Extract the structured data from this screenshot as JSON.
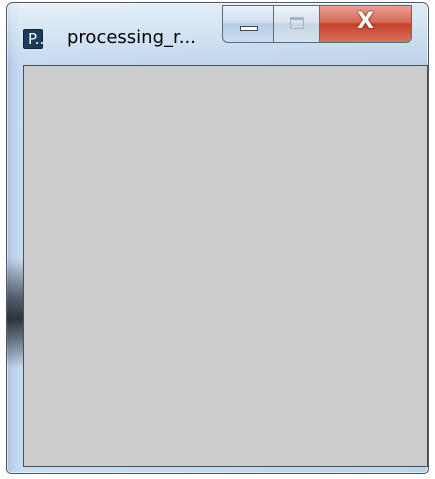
{
  "window": {
    "title": "processing_r...",
    "app_icon": "processing-app-icon",
    "app_icon_glyph": "P..",
    "caption_buttons": {
      "minimize": "minimize-icon",
      "maximize": "maximize-icon",
      "close": "close-icon"
    },
    "close_glyph": "X"
  },
  "canvas": {
    "background": "#cccccc"
  }
}
